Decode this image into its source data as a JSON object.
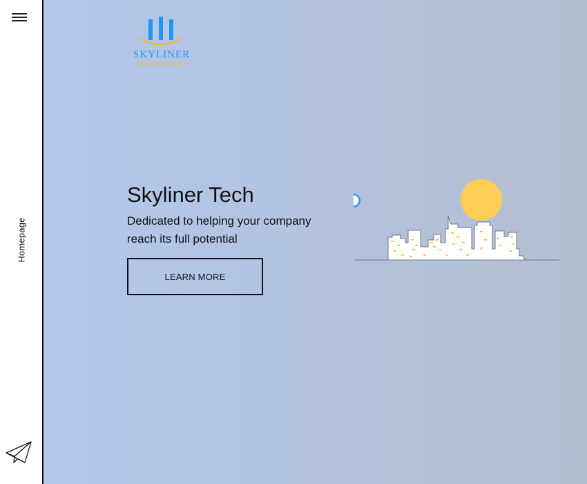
{
  "sidebar": {
    "menu_icon": "hamburger-menu-icon",
    "page_label": "Homepage",
    "contact_icon": "paper-plane-icon"
  },
  "logo": {
    "name": "SKYLINER",
    "subtitle": "TECHNOLOGIES",
    "icon": "skyline-bars-logo-icon"
  },
  "hero": {
    "title": "Skyliner Tech",
    "tagline": "Dedicated to helping your company reach its full potential",
    "cta_label": "LEARN MORE",
    "illustration": "city-skyline-sun-illustration"
  },
  "colors": {
    "brand_blue": "#2196f3",
    "brand_yellow": "#f5b82e",
    "sun_yellow": "#fdcd55",
    "background_left": "#b2c8ef",
    "background_right": "#b3bfcf"
  }
}
